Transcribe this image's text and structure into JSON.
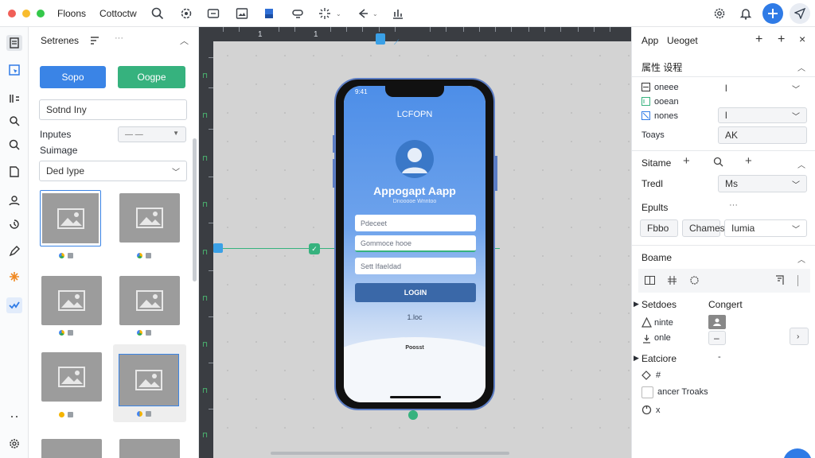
{
  "topbar": {
    "menu": [
      "Floons",
      "Cottoctw"
    ],
    "dots": [
      "#f05f57",
      "#f8bc2e",
      "#34c84a"
    ]
  },
  "left_panel": {
    "header_label": "Setrenes",
    "btn_primary": "Sopo",
    "btn_secondary": "Oogpe",
    "text_field": "Sotnd Iny",
    "inputs_label": "Inputes",
    "inputs_select": "— —",
    "sumage_label": "Suimage",
    "type_select": "Ded Iype"
  },
  "phone": {
    "status_time": "9:41",
    "header": "LCFOPN",
    "app_title": "Appogapt Aapp",
    "app_subtitle": "Dnooooe Wnntoo",
    "field1": "Pdeceet",
    "field2": "Gommoce hooe",
    "field3": "Sett IfaeIdad",
    "login_button": "LOGIN",
    "link": "1.loc",
    "footer": "Poosst"
  },
  "right_panel": {
    "title": "App",
    "subtitle": "Ueoget",
    "section1": "属性 设程",
    "props": [
      {
        "label": "oneee",
        "value": "l"
      },
      {
        "label": "ooean",
        "value": ""
      },
      {
        "label": "nones",
        "value": "l"
      },
      {
        "label": "Toays",
        "value": "AK"
      }
    ],
    "section2": "Sitame",
    "tredl_label": "Tredl",
    "tredl_value": "Ms",
    "epults_label": "Epults",
    "epults_more": "···",
    "chip1": "Fbbo",
    "chip2": "Chames",
    "chip3_select": "Iumia",
    "section3": "Boame",
    "setdoes_label": "Setdoes",
    "congert_label": "Congert",
    "ninte_label": "ninte",
    "onle_label": "onle",
    "onle_select": "–",
    "eatciore_label": "Eatciore",
    "eatciore_value": "-",
    "hash_label": "#",
    "ancer_label": "ancer Troaks",
    "x_label": "x"
  }
}
